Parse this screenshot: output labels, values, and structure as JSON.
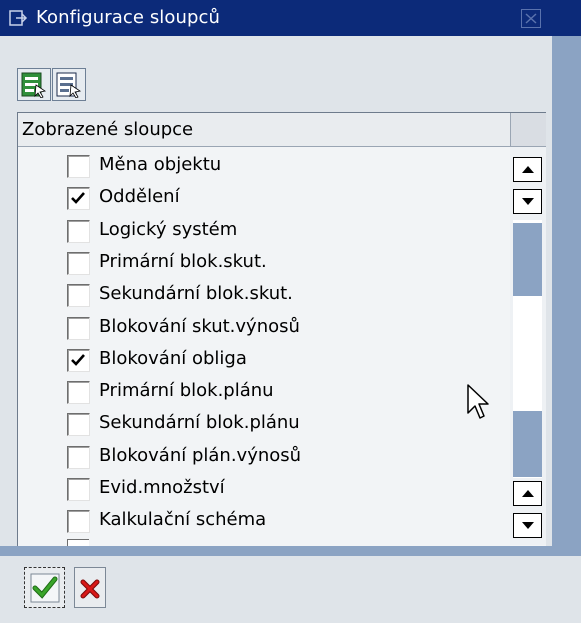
{
  "window": {
    "title": "Konfigurace sloupců",
    "title_icon": "dialog-icon",
    "close_icon": "close-icon"
  },
  "toolbar": {
    "buttons": [
      {
        "icon": "select-all-icon"
      },
      {
        "icon": "deselect-all-icon"
      }
    ]
  },
  "table": {
    "column_header": "Zobrazené sloupce",
    "rows": [
      {
        "label": "Měna objektu",
        "checked": false
      },
      {
        "label": "Oddělení",
        "checked": true
      },
      {
        "label": "Logický systém",
        "checked": false
      },
      {
        "label": "Primární blok.skut.",
        "checked": false
      },
      {
        "label": "Sekundární blok.skut.",
        "checked": false
      },
      {
        "label": "Blokování skut.výnosů",
        "checked": false
      },
      {
        "label": "Blokování obliga",
        "checked": true
      },
      {
        "label": "Primární blok.plánu",
        "checked": false
      },
      {
        "label": "Sekundární blok.plánu",
        "checked": false
      },
      {
        "label": "Blokování plán.výnosů",
        "checked": false
      },
      {
        "label": "Evid.množství",
        "checked": false
      },
      {
        "label": "Kalkulační schéma",
        "checked": false
      }
    ]
  },
  "footer": {
    "ok_icon": "checkmark-icon",
    "cancel_icon": "cancel-x-icon"
  },
  "colors": {
    "titlebar": "#0c2a79",
    "frame": "#8ba3c3",
    "panel": "#dfe4e9",
    "ok_green": "#3aa52a",
    "cancel_red": "#d81818"
  }
}
